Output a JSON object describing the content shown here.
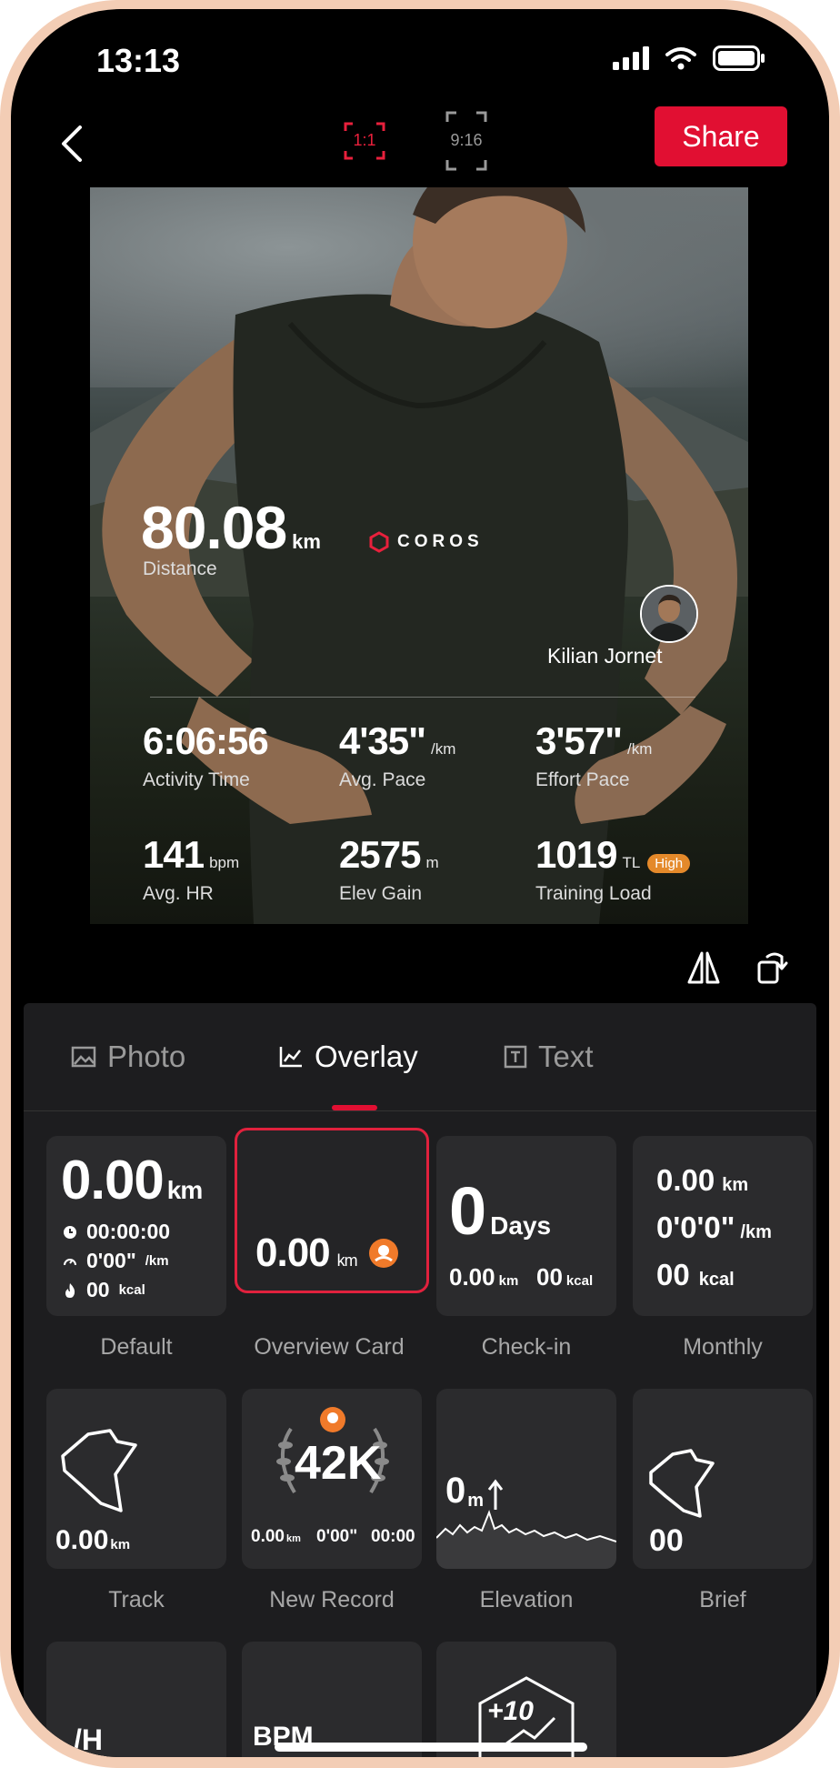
{
  "status_bar": {
    "time": "13:13"
  },
  "top_bar": {
    "ratio_options": [
      "1:1",
      "9:16"
    ],
    "selected_ratio": "1:1",
    "share_label": "Share",
    "accent_color": "#e10f32"
  },
  "preview": {
    "brand": "COROS",
    "distance": {
      "value": "80.08",
      "unit": "km",
      "label": "Distance"
    },
    "user_name": "Kilian Jornet",
    "stats": [
      {
        "value": "6:06:56",
        "unit": "",
        "label": "Activity Time"
      },
      {
        "value": "4'35\"",
        "unit": "/km",
        "label": "Avg. Pace"
      },
      {
        "value": "3'57\"",
        "unit": "/km",
        "label": "Effort Pace"
      },
      {
        "value": "141",
        "unit": "bpm",
        "label": "Avg. HR"
      },
      {
        "value": "2575",
        "unit": "m",
        "label": "Elev Gain"
      },
      {
        "value": "1019",
        "unit": "TL",
        "badge": "High",
        "label": "Training Load"
      }
    ]
  },
  "tabs": [
    {
      "label": "Photo",
      "icon": "image-icon"
    },
    {
      "label": "Overlay",
      "icon": "chart-line-icon",
      "active": true
    },
    {
      "label": "Text",
      "icon": "text-box-icon"
    }
  ],
  "templates": [
    {
      "label": "Default",
      "preview": {
        "distance": "0.00",
        "dist_unit": "km",
        "time": "00:00:00",
        "pace": "0'00\"",
        "pace_unit": "/km",
        "calories": "00",
        "cal_unit": "kcal"
      }
    },
    {
      "label": "Overview Card",
      "selected": true,
      "preview": {
        "distance": "0.00",
        "dist_unit": "km"
      }
    },
    {
      "label": "Check-in",
      "preview": {
        "days": "0",
        "days_unit": "Days",
        "distance": "0.00",
        "dist_unit": "km",
        "calories": "00",
        "cal_unit": "kcal"
      }
    },
    {
      "label": "Monthly",
      "preview": {
        "distance": "0.00",
        "dist_unit": "km",
        "pace": "0'0'0\"",
        "pace_unit": "/km",
        "calories": "00",
        "cal_unit": "kcal"
      }
    },
    {
      "label": "Track",
      "preview": {
        "distance": "0.00",
        "dist_unit": "km"
      }
    },
    {
      "label": "New Record",
      "preview": {
        "record": "42K",
        "distance": "0.00",
        "dist_unit": "km",
        "pace": "0'00\"",
        "time": "00:00"
      }
    },
    {
      "label": "Elevation",
      "preview": {
        "elevation": "0",
        "elev_unit": "m"
      }
    },
    {
      "label": "Brief",
      "preview": {
        "value": "00"
      }
    },
    {
      "label": "",
      "preview": {
        "text": "/H"
      }
    },
    {
      "label": "",
      "preview": {
        "text": "BPM"
      }
    },
    {
      "label": "",
      "preview": {
        "text": "+10"
      }
    }
  ]
}
